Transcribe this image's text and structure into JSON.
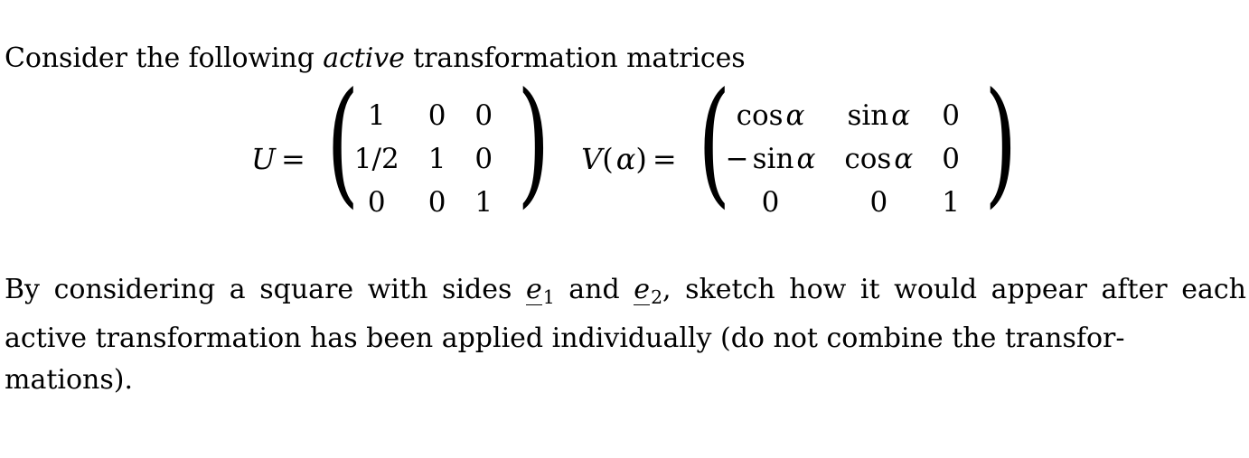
{
  "document": {
    "intro": {
      "before_emph": "Consider the following ",
      "emph": "active",
      "after_emph": " transformation matrices"
    },
    "equations": [
      {
        "name": "U",
        "label": "U",
        "equals": "=",
        "left_bracket": "(",
        "right_bracket": ")",
        "rows": [
          [
            "1",
            "0",
            "0"
          ],
          [
            "1/2",
            "1",
            "0"
          ],
          [
            "0",
            "0",
            "1"
          ]
        ]
      },
      {
        "name": "V",
        "label_fn": "V",
        "label_open": "(",
        "label_arg": "α",
        "label_close": ")",
        "equals": "=",
        "left_bracket": "(",
        "right_bracket": ")",
        "rows": [
          [
            {
              "fn": "cos",
              "arg": "α"
            },
            {
              "fn": "sin",
              "arg": "α"
            },
            {
              "plain": "0"
            }
          ],
          [
            {
              "sign": "−",
              "fn": "sin",
              "arg": "α"
            },
            {
              "fn": "cos",
              "arg": "α"
            },
            {
              "plain": "0"
            }
          ],
          [
            {
              "plain": "0"
            },
            {
              "plain": "0"
            },
            {
              "plain": "1"
            }
          ]
        ]
      }
    ],
    "paragraph": {
      "seg1": "By considering a square with sides ",
      "vec1_letter": "e",
      "vec1_sub": "1",
      "seg2": " and ",
      "vec2_letter": "e",
      "vec2_sub": "2",
      "seg3": ", sketch how it would appear after each active transformation has been applied individually (do not combine the transfor-",
      "seg4": "mations)."
    },
    "colors": {
      "background": "#ffffff",
      "text": "#000000"
    }
  }
}
